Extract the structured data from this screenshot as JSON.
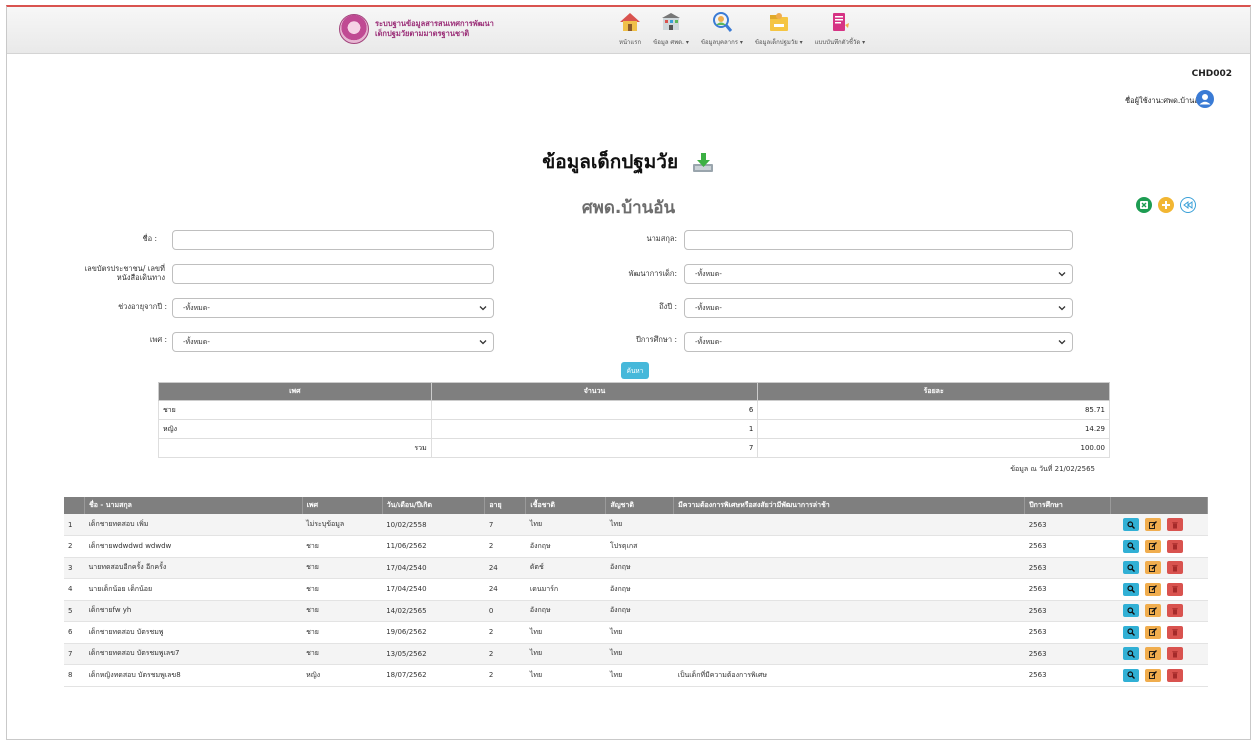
{
  "brand": {
    "line1": "ระบบฐานข้อมูลสารสนเทศการพัฒนา",
    "line2": "เด็กปฐมวัยตามมาตรฐานชาติ"
  },
  "nav": [
    {
      "label": "หน้าแรก",
      "icon": "home-icon"
    },
    {
      "label": "ข้อมูล ศพด. ▾",
      "icon": "building-icon"
    },
    {
      "label": "ข้อมูลบุคลากร ▾",
      "icon": "staff-search-icon"
    },
    {
      "label": "ข้อมูลเด็กปฐมวัย ▾",
      "icon": "child-folder-icon"
    },
    {
      "label": "แบบบันทึกตัวชี้วัด ▾",
      "icon": "report-icon"
    }
  ],
  "center_code": "CHD002",
  "user": {
    "label": "ชื่อผู้ใช้งาน:ศพด.บ้านอัน"
  },
  "page": {
    "title": "ข้อมูลเด็กปฐมวัย",
    "center_name": "ศพด.บ้านอัน"
  },
  "filters": {
    "name_label": "ชื่อ :",
    "surname_label": "นามสกุล:",
    "id_label": "เลขบัตรประชาชน/ เลขที่หนังสือเดินทาง",
    "development_label": "พัฒนาการเด็ก:",
    "development_value": "-ทั้งหมด-",
    "age_from_label": "ช่วงอายุจากปี :",
    "age_from_value": "-ทั้งหมด-",
    "age_to_label": "ถึงปี :",
    "age_to_value": "-ทั้งหมด-",
    "gender_label": "เพศ :",
    "gender_value": "-ทั้งหมด-",
    "year_label": "ปีการศึกษา :",
    "year_value": "-ทั้งหมด-",
    "search_button": "ค้นหา"
  },
  "summary": {
    "headers": [
      "เพศ",
      "จำนวน",
      "ร้อยละ"
    ],
    "rows": [
      {
        "gender": "ชาย",
        "count": "6",
        "percent": "85.71"
      },
      {
        "gender": "หญิง",
        "count": "1",
        "percent": "14.29"
      }
    ],
    "total": {
      "label": "รวม",
      "count": "7",
      "percent": "100.00"
    },
    "data_date": "ข้อมูล ณ วันที่ 21/02/2565"
  },
  "children": {
    "headers": [
      "",
      "ชื่อ - นามสกุล",
      "เพศ",
      "วัน/เดือน/ปีเกิด",
      "อายุ",
      "เชื้อชาติ",
      "สัญชาติ",
      "มีความต้องการพิเศษหรือสงสัยว่ามีพัฒนาการล่าช้า",
      "ปีการศึกษา",
      ""
    ],
    "rows": [
      {
        "no": "1",
        "name": "เด็กชายทดสอบ เพิ่ม",
        "gender": "ไม่ระบุข้อมูล",
        "dob": "10/02/2558",
        "age": "7",
        "race": "ไทย",
        "nationality": "ไทย",
        "special": "",
        "year": "2563"
      },
      {
        "no": "2",
        "name": "เด็กชายwdwdwd wdwdw",
        "gender": "ชาย",
        "dob": "11/06/2562",
        "age": "2",
        "race": "อังกฤษ",
        "nationality": "โปรตุเกส",
        "special": "",
        "year": "2563"
      },
      {
        "no": "3",
        "name": "นายทดสอบอีกครั้ง อีกครั้ง",
        "gender": "ชาย",
        "dob": "17/04/2540",
        "age": "24",
        "race": "ดัตช์",
        "nationality": "อังกฤษ",
        "special": "",
        "year": "2563"
      },
      {
        "no": "4",
        "name": "นายเด็กน้อย เด็กน้อย",
        "gender": "ชาย",
        "dob": "17/04/2540",
        "age": "24",
        "race": "เดนมาร์ก",
        "nationality": "อังกฤษ",
        "special": "",
        "year": "2563"
      },
      {
        "no": "5",
        "name": "เด็กชายfw yh",
        "gender": "ชาย",
        "dob": "14/02/2565",
        "age": "0",
        "race": "อังกฤษ",
        "nationality": "อังกฤษ",
        "special": "",
        "year": "2563"
      },
      {
        "no": "6",
        "name": "เด็กชายทดสอบ บัตรชมพู",
        "gender": "ชาย",
        "dob": "19/06/2562",
        "age": "2",
        "race": "ไทย",
        "nationality": "ไทย",
        "special": "",
        "year": "2563"
      },
      {
        "no": "7",
        "name": "เด็กชายทดสอบ บัตรชมพูเลข7",
        "gender": "ชาย",
        "dob": "13/05/2562",
        "age": "2",
        "race": "ไทย",
        "nationality": "ไทย",
        "special": "",
        "year": "2563"
      },
      {
        "no": "8",
        "name": "เด็กหญิงทดสอบ บัตรชมพูเลข8",
        "gender": "หญิง",
        "dob": "18/07/2562",
        "age": "2",
        "race": "ไทย",
        "nationality": "ไทย",
        "special": "เป็นเด็กที่มีความต้องการพิเศษ",
        "year": "2563"
      }
    ]
  },
  "colors": {
    "accent": "#46b8da",
    "header_gray": "#7f7f7f",
    "view": "#31b0d5",
    "edit": "#f0ad4e",
    "delete": "#d9534f",
    "excel": "#1d9c52",
    "add": "#f2b632",
    "back": "#3aa0d8"
  }
}
